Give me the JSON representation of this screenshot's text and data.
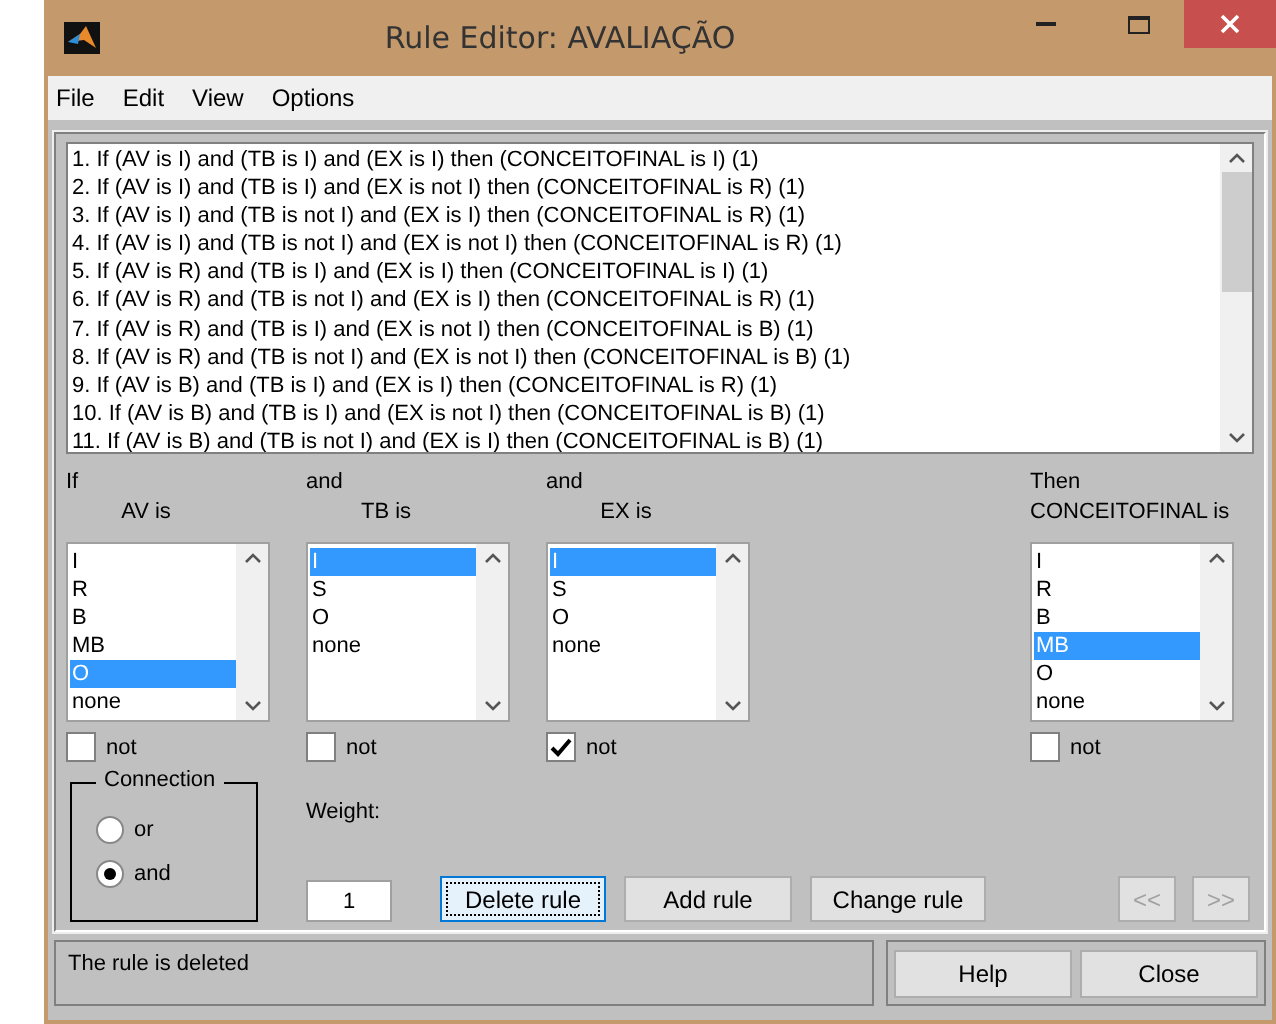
{
  "window": {
    "title": "Rule Editor: AVALIAÇÃO"
  },
  "menu": [
    "File",
    "Edit",
    "View",
    "Options"
  ],
  "rules": [
    "1. If (AV is I) and (TB is I) and (EX is I) then (CONCEITOFINAL is I) (1)",
    "2. If (AV is I) and (TB is I) and (EX is not I) then (CONCEITOFINAL is R) (1)",
    "3. If (AV is I) and (TB is not I) and (EX is I) then (CONCEITOFINAL is R) (1)",
    "4. If (AV is I) and (TB is not I) and (EX is not I) then (CONCEITOFINAL is R) (1)",
    "5. If (AV is R) and (TB is I) and (EX is I) then (CONCEITOFINAL is I) (1)",
    "6. If (AV is R) and (TB is not I) and (EX is I) then (CONCEITOFINAL is R) (1)",
    "7. If (AV is R) and (TB is I) and (EX is not I) then (CONCEITOFINAL is B) (1)",
    "8. If (AV is R) and (TB is not I) and (EX is not I) then (CONCEITOFINAL is B) (1)",
    "9. If (AV is B) and (TB is I) and (EX is I) then (CONCEITOFINAL is R) (1)",
    "10. If (AV is B) and (TB is I) and (EX is not I) then (CONCEITOFINAL is B) (1)",
    "11. If (AV is B) and (TB is not I) and (EX is I) then (CONCEITOFINAL is B) (1)"
  ],
  "variables": [
    {
      "kind": "input",
      "connector": "If",
      "label": "AV is",
      "not_label": "not",
      "not_checked": false,
      "items": [
        {
          "label": "I",
          "selected": false
        },
        {
          "label": "R",
          "selected": false
        },
        {
          "label": "B",
          "selected": false
        },
        {
          "label": "MB",
          "selected": false
        },
        {
          "label": "O",
          "selected": true
        },
        {
          "label": "none",
          "selected": false
        }
      ]
    },
    {
      "kind": "input",
      "connector": "and",
      "label": "TB is",
      "not_label": "not",
      "not_checked": false,
      "items": [
        {
          "label": "I",
          "selected": true
        },
        {
          "label": "S",
          "selected": false
        },
        {
          "label": "O",
          "selected": false
        },
        {
          "label": "none",
          "selected": false
        }
      ]
    },
    {
      "kind": "input",
      "connector": "and",
      "label": "EX is",
      "not_label": "not",
      "not_checked": true,
      "items": [
        {
          "label": "I",
          "selected": true
        },
        {
          "label": "S",
          "selected": false
        },
        {
          "label": "O",
          "selected": false
        },
        {
          "label": "none",
          "selected": false
        }
      ]
    },
    {
      "kind": "output",
      "connector": "Then",
      "label": "CONCEITOFINAL is",
      "not_label": "not",
      "not_checked": false,
      "items": [
        {
          "label": "I",
          "selected": false
        },
        {
          "label": "R",
          "selected": false
        },
        {
          "label": "B",
          "selected": false
        },
        {
          "label": "MB",
          "selected": true
        },
        {
          "label": "O",
          "selected": false
        },
        {
          "label": "none",
          "selected": false
        }
      ]
    }
  ],
  "connection": {
    "title": "Connection",
    "options": [
      {
        "label": "or",
        "selected": false
      },
      {
        "label": "and",
        "selected": true
      }
    ]
  },
  "weight": {
    "label": "Weight:",
    "value": "1"
  },
  "rule_buttons": [
    {
      "label": "Delete rule",
      "focused": true
    },
    {
      "label": "Add rule",
      "focused": false
    },
    {
      "label": "Change rule",
      "focused": false
    }
  ],
  "nav_buttons": [
    {
      "label": "<<",
      "disabled": true
    },
    {
      "label": ">>",
      "disabled": true
    }
  ],
  "status": "The rule is deleted",
  "footer_buttons": [
    "Help",
    "Close"
  ]
}
